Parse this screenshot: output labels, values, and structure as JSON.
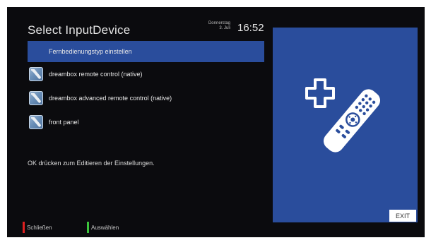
{
  "header": {
    "title": "Select InputDevice",
    "date_line1": "Donnerstag",
    "date_line2": "3. Juli",
    "time": "16:52"
  },
  "menu": {
    "items": [
      {
        "label": "Fernbedienungstyp einstellen",
        "selected": true,
        "icon": null
      },
      {
        "label": "dreambox remote control (native)",
        "selected": false,
        "icon": "remote-device-icon"
      },
      {
        "label": "dreambox advanced remote control (native)",
        "selected": false,
        "icon": "remote-device-icon"
      },
      {
        "label": "front panel",
        "selected": false,
        "icon": "remote-device-icon"
      }
    ]
  },
  "hint": "OK drücken zum Editieren der Einstellungen.",
  "panel": {
    "illustration": "remote-control-plus-icon",
    "exit_label": "EXIT"
  },
  "footer": {
    "close_label": "Schließen",
    "close_color": "#e02020",
    "select_label": "Auswählen",
    "select_color": "#3cc43c"
  },
  "colors": {
    "background": "#0b0b0e",
    "accent": "#2a4d9c",
    "text": "#e6e6e6"
  }
}
